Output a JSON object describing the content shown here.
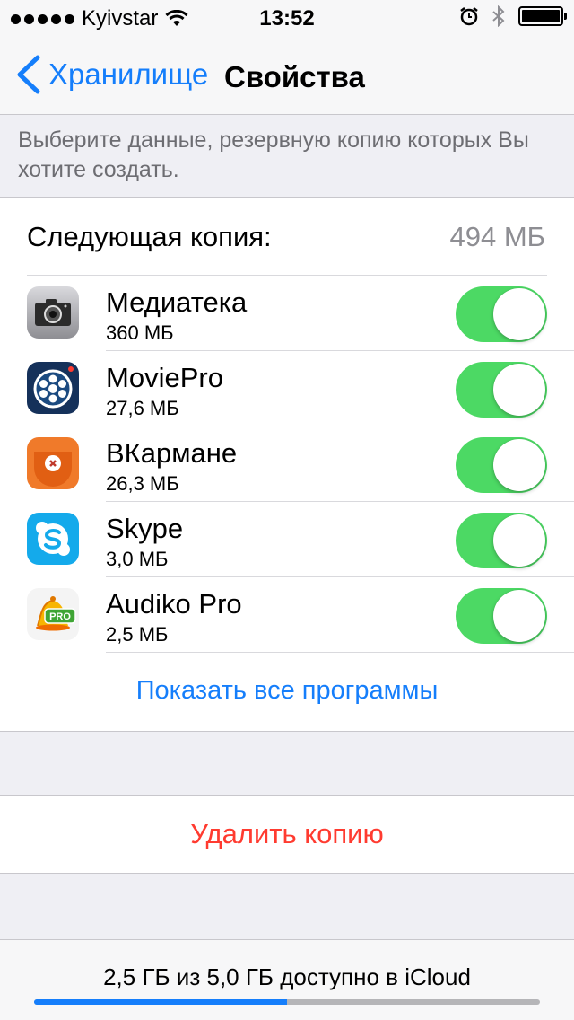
{
  "status_bar": {
    "carrier": "Kyivstar",
    "time": "13:52"
  },
  "nav": {
    "back_label": "Хранилище",
    "title": "Свойства"
  },
  "description": "Выберите данные, резервную копию которых Вы хотите создать.",
  "next_backup": {
    "label": "Следующая копия:",
    "value": "494 МБ"
  },
  "apps": [
    {
      "name": "Медиатека",
      "size": "360 МБ",
      "icon": "camera-icon",
      "enabled": true
    },
    {
      "name": "MoviePro",
      "size": "27,6 МБ",
      "icon": "film-reel-icon",
      "enabled": true
    },
    {
      "name": "ВКармане",
      "size": "26,3 МБ",
      "icon": "pocket-icon",
      "enabled": true
    },
    {
      "name": "Skype",
      "size": "3,0 МБ",
      "icon": "skype-icon",
      "enabled": true
    },
    {
      "name": "Audiko Pro",
      "size": "2,5 МБ",
      "icon": "bell-pro-icon",
      "enabled": true
    }
  ],
  "show_all_label": "Показать все программы",
  "delete_label": "Удалить копию",
  "storage": {
    "text": "2,5 ГБ из 5,0 ГБ доступно в iCloud",
    "used_fraction": 0.5
  },
  "colors": {
    "accent": "#157efb",
    "toggle_on": "#4cd964",
    "destructive": "#ff3b30"
  }
}
